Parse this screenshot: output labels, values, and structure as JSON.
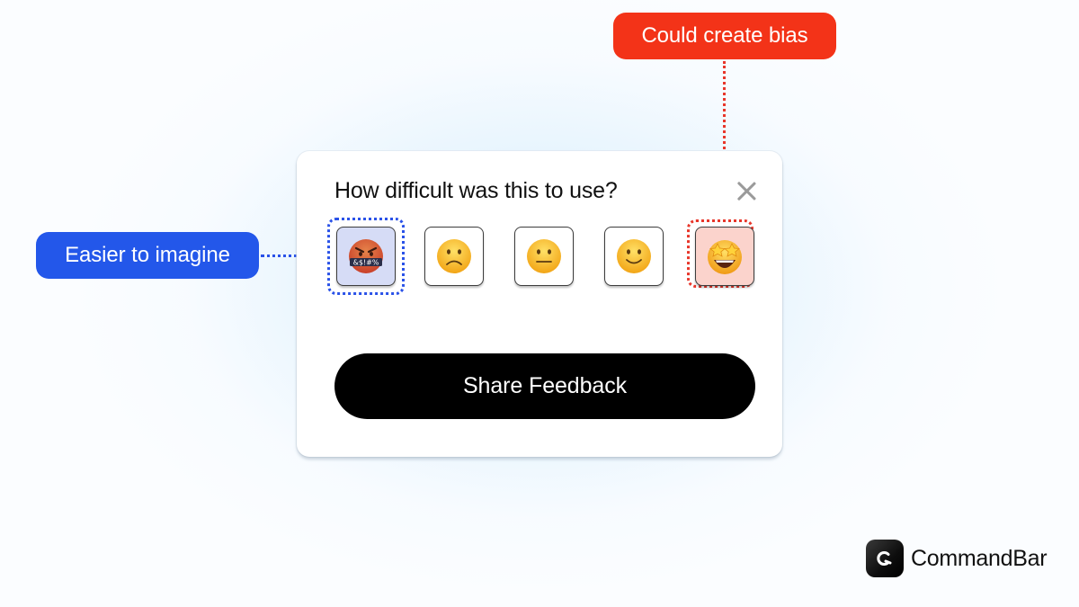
{
  "annotations": {
    "left_tag": {
      "label": "Easier to imagine",
      "color": "#2357ea"
    },
    "top_tag": {
      "label": "Could create bias",
      "color": "#f33318"
    }
  },
  "survey": {
    "question": "How difficult was this to use?",
    "close_icon": "close-icon",
    "options": [
      {
        "emoji": "🤬",
        "name": "face-with-symbols-on-mouth",
        "highlight": "blue"
      },
      {
        "emoji": "🙁",
        "name": "slightly-frowning-face",
        "highlight": null
      },
      {
        "emoji": "😐",
        "name": "neutral-face",
        "highlight": null
      },
      {
        "emoji": "🙂",
        "name": "slightly-smiling-face",
        "highlight": null
      },
      {
        "emoji": "🤩",
        "name": "star-struck",
        "highlight": "red"
      }
    ],
    "submit_label": "Share Feedback"
  },
  "brand": {
    "name": "CommandBar",
    "logo_icon": "commandbar-logo-icon"
  }
}
